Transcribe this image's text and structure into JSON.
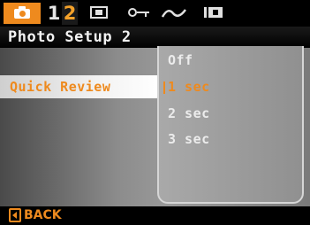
{
  "tabbar": {
    "active_tab_icon": "camera-icon",
    "pages": [
      "1",
      "2"
    ],
    "active_page": "2",
    "other_tabs": [
      "frame-icon",
      "key-icon",
      "wave-icon",
      "doc-icon"
    ],
    "accent_color": "#ee8a1e"
  },
  "title": "Photo Setup 2",
  "menu": {
    "selected_item_label": "Quick Review"
  },
  "options": {
    "items": [
      "Off",
      "1 sec",
      "2 sec",
      "3 sec"
    ],
    "selected": "1 sec"
  },
  "bottom": {
    "back_label": "BACK",
    "back_icon": "back-arrow-icon"
  }
}
